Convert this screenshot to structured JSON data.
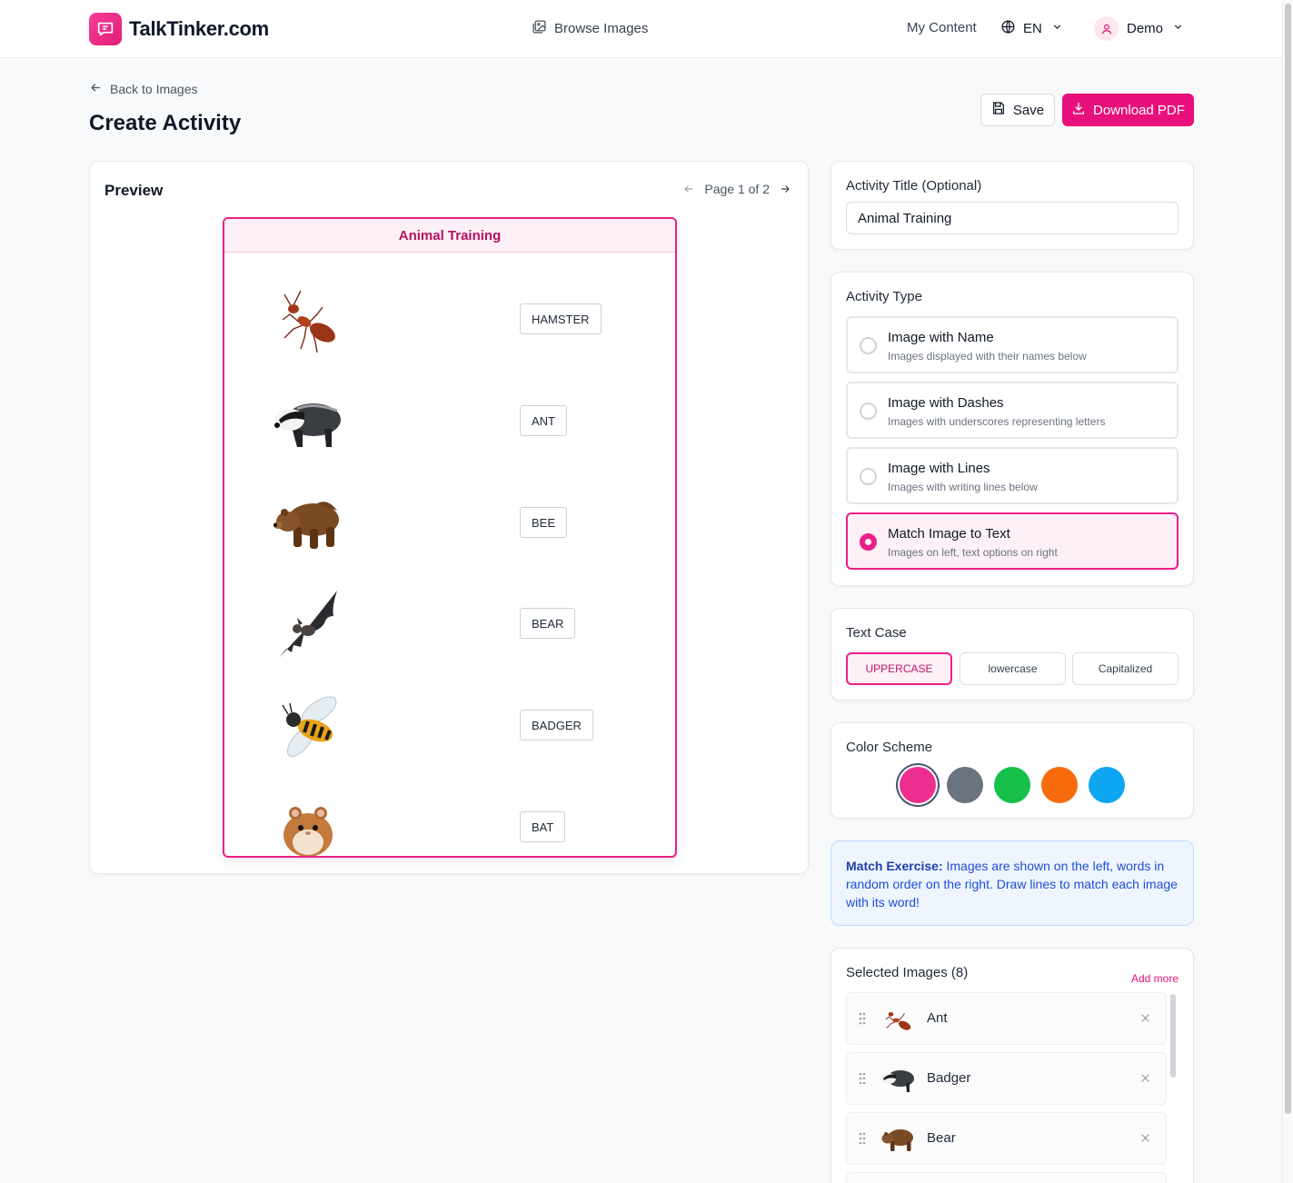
{
  "header": {
    "brand": "TalkTinker.com",
    "browse_label": "Browse Images",
    "my_content_label": "My Content",
    "language": "EN",
    "user_name": "Demo"
  },
  "page": {
    "back_label": "Back to Images",
    "title": "Create Activity",
    "save_label": "Save",
    "download_label": "Download PDF"
  },
  "preview": {
    "label": "Preview",
    "pagination": "Page 1 of 2",
    "sheet_title": "Animal Training",
    "rows": [
      {
        "animal": "ant",
        "word": "HAMSTER"
      },
      {
        "animal": "badger",
        "word": "ANT"
      },
      {
        "animal": "bear",
        "word": "BEE"
      },
      {
        "animal": "bat",
        "word": "BEAR"
      },
      {
        "animal": "bee",
        "word": "BADGER"
      },
      {
        "animal": "hamster",
        "word": "BAT"
      }
    ]
  },
  "settings": {
    "title_label": "Activity Title (Optional)",
    "title_value": "Animal Training",
    "type_label": "Activity Type",
    "types": [
      {
        "title": "Image with Name",
        "desc": "Images displayed with their names below",
        "selected": false
      },
      {
        "title": "Image with Dashes",
        "desc": "Images with underscores representing letters",
        "selected": false
      },
      {
        "title": "Image with Lines",
        "desc": "Images with writing lines below",
        "selected": false
      },
      {
        "title": "Match Image to Text",
        "desc": "Images on left, text options on right",
        "selected": true
      }
    ],
    "case_label": "Text Case",
    "cases": [
      {
        "label": "UPPERCASE",
        "selected": true
      },
      {
        "label": "lowercase",
        "selected": false
      },
      {
        "label": "Capitalized",
        "selected": false
      }
    ],
    "color_label": "Color Scheme",
    "colors": [
      "#ec2f8f",
      "#6b7280",
      "#16c04a",
      "#f76b0c",
      "#0ea5f1"
    ],
    "selected_color": "#ec2f8f"
  },
  "info": {
    "bold": "Match Exercise:",
    "text": " Images are shown on the left, words in random order on the right. Draw lines to match each image with its word!"
  },
  "selected_images": {
    "label": "Selected Images (8)",
    "add_more": "Add more",
    "items": [
      {
        "animal": "ant",
        "name": "Ant"
      },
      {
        "animal": "badger",
        "name": "Badger"
      },
      {
        "animal": "bear",
        "name": "Bear"
      }
    ]
  },
  "icons": {
    "brand": "chat-bubble-icon",
    "browse": "image-gallery-icon",
    "language": "globe-icon",
    "user": "user-icon",
    "back": "arrow-left-icon",
    "save": "floppy-disk-icon",
    "download": "download-icon",
    "drag": "drag-handle-icon",
    "remove": "close-icon"
  }
}
